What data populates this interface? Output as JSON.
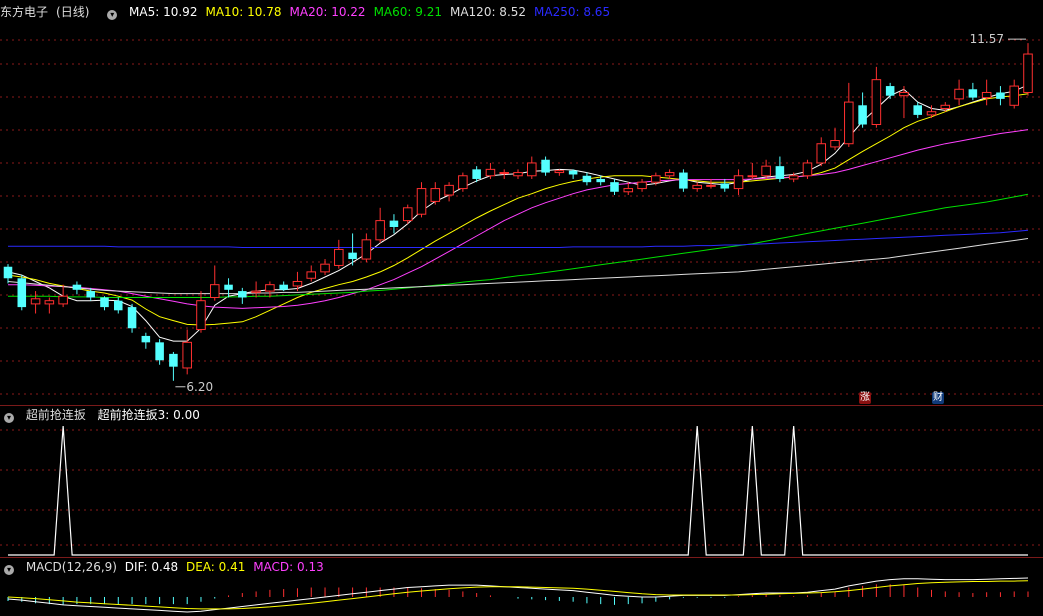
{
  "main": {
    "stock_name": "东方电子",
    "period": "(日线)",
    "ma_legend": [
      {
        "label": "MA5: 10.92",
        "color": "#ffffff"
      },
      {
        "label": "MA10: 10.78",
        "color": "#ffff00"
      },
      {
        "label": "MA20: 10.22",
        "color": "#ff40ff"
      },
      {
        "label": "MA60: 9.21",
        "color": "#00e000"
      },
      {
        "label": "MA120: 8.52",
        "color": "#dddddd"
      },
      {
        "label": "MA250: 8.65",
        "color": "#2a2aff"
      }
    ],
    "high_marker": "11.57",
    "low_marker": "6.20",
    "badges": [
      {
        "label": "涨",
        "bg": "#8a1010",
        "color": "#ffffff"
      },
      {
        "label": "财",
        "bg": "#103a7a",
        "color": "#ffffff"
      }
    ]
  },
  "indicator": {
    "name": "超前抢连扳",
    "legend": "超前抢连扳3: 0.00"
  },
  "macd": {
    "name": "MACD(12,26,9)",
    "dif": "DIF: 0.48",
    "dea": "DEA: 0.41",
    "macd": "MACD: 0.13"
  },
  "colors": {
    "up": "#ff3030",
    "down": "#54ffff",
    "grid": "#8a1a1a"
  },
  "chart_data": {
    "type": "candlestick",
    "ylim": [
      6.0,
      11.9
    ],
    "candles": [
      [
        8.08,
        7.9,
        8.12,
        7.82
      ],
      [
        7.9,
        7.45,
        7.95,
        7.4
      ],
      [
        7.5,
        7.58,
        7.7,
        7.35
      ],
      [
        7.5,
        7.55,
        7.6,
        7.35
      ],
      [
        7.5,
        7.62,
        7.8,
        7.45
      ],
      [
        7.8,
        7.72,
        7.85,
        7.65
      ],
      [
        7.7,
        7.6,
        7.75,
        7.55
      ],
      [
        7.6,
        7.45,
        7.62,
        7.4
      ],
      [
        7.55,
        7.4,
        7.6,
        7.35
      ],
      [
        7.45,
        7.12,
        7.5,
        7.05
      ],
      [
        7.0,
        6.9,
        7.05,
        6.8
      ],
      [
        6.9,
        6.62,
        6.95,
        6.55
      ],
      [
        6.72,
        6.52,
        6.75,
        6.3
      ],
      [
        6.5,
        6.9,
        7.1,
        6.4
      ],
      [
        7.1,
        7.55,
        7.7,
        7.05
      ],
      [
        7.6,
        7.8,
        8.1,
        7.55
      ],
      [
        7.8,
        7.72,
        7.9,
        7.6
      ],
      [
        7.7,
        7.6,
        7.75,
        7.5
      ],
      [
        7.68,
        7.7,
        7.85,
        7.6
      ],
      [
        7.7,
        7.8,
        7.85,
        7.6
      ],
      [
        7.8,
        7.72,
        7.85,
        7.7
      ],
      [
        7.78,
        7.85,
        8.0,
        7.7
      ],
      [
        7.9,
        8.0,
        8.1,
        7.85
      ],
      [
        8.0,
        8.12,
        8.2,
        7.95
      ],
      [
        8.1,
        8.35,
        8.5,
        8.05
      ],
      [
        8.3,
        8.2,
        8.6,
        8.1
      ],
      [
        8.2,
        8.5,
        8.6,
        8.15
      ],
      [
        8.5,
        8.8,
        9.0,
        8.45
      ],
      [
        8.8,
        8.7,
        8.9,
        8.6
      ],
      [
        8.8,
        9.0,
        9.05,
        8.75
      ],
      [
        8.9,
        9.3,
        9.4,
        8.85
      ],
      [
        9.1,
        9.3,
        9.4,
        9.05
      ],
      [
        9.2,
        9.35,
        9.4,
        9.1
      ],
      [
        9.3,
        9.5,
        9.55,
        9.25
      ],
      [
        9.6,
        9.45,
        9.65,
        9.4
      ],
      [
        9.5,
        9.6,
        9.7,
        9.45
      ],
      [
        9.55,
        9.55,
        9.6,
        9.45
      ],
      [
        9.5,
        9.55,
        9.6,
        9.45
      ],
      [
        9.5,
        9.7,
        9.8,
        9.45
      ],
      [
        9.75,
        9.55,
        9.8,
        9.5
      ],
      [
        9.55,
        9.58,
        9.6,
        9.5
      ],
      [
        9.58,
        9.52,
        9.6,
        9.45
      ],
      [
        9.5,
        9.4,
        9.55,
        9.35
      ],
      [
        9.45,
        9.4,
        9.5,
        9.35
      ],
      [
        9.4,
        9.25,
        9.45,
        9.2
      ],
      [
        9.25,
        9.3,
        9.4,
        9.2
      ],
      [
        9.3,
        9.4,
        9.45,
        9.25
      ],
      [
        9.4,
        9.5,
        9.55,
        9.35
      ],
      [
        9.5,
        9.55,
        9.6,
        9.45
      ],
      [
        9.55,
        9.3,
        9.6,
        9.25
      ],
      [
        9.3,
        9.35,
        9.4,
        9.25
      ],
      [
        9.35,
        9.35,
        9.45,
        9.3
      ],
      [
        9.38,
        9.3,
        9.45,
        9.25
      ],
      [
        9.3,
        9.5,
        9.6,
        9.2
      ],
      [
        9.5,
        9.5,
        9.7,
        9.45
      ],
      [
        9.5,
        9.65,
        9.75,
        9.45
      ],
      [
        9.65,
        9.45,
        9.8,
        9.4
      ],
      [
        9.45,
        9.5,
        9.55,
        9.4
      ],
      [
        9.5,
        9.7,
        9.75,
        9.45
      ],
      [
        9.7,
        10.0,
        10.1,
        9.65
      ],
      [
        9.95,
        10.05,
        10.25,
        9.9
      ],
      [
        10.0,
        10.65,
        10.95,
        9.95
      ],
      [
        10.6,
        10.3,
        10.8,
        10.25
      ],
      [
        10.3,
        11.0,
        11.2,
        10.25
      ],
      [
        10.9,
        10.75,
        10.95,
        10.7
      ],
      [
        10.75,
        10.8,
        10.9,
        10.4
      ],
      [
        10.6,
        10.45,
        10.65,
        10.4
      ],
      [
        10.45,
        10.5,
        10.6,
        10.4
      ],
      [
        10.55,
        10.6,
        10.65,
        10.5
      ],
      [
        10.7,
        10.85,
        11.0,
        10.6
      ],
      [
        10.85,
        10.72,
        10.95,
        10.68
      ],
      [
        10.72,
        10.8,
        11.0,
        10.6
      ],
      [
        10.8,
        10.7,
        10.9,
        10.6
      ],
      [
        10.6,
        10.9,
        11.0,
        10.55
      ],
      [
        10.8,
        11.4,
        11.57,
        10.75
      ]
    ],
    "series": [
      {
        "name": "MA5",
        "color": "#ffffff",
        "values": [
          8.0,
          7.95,
          7.85,
          7.75,
          7.62,
          7.55,
          7.55,
          7.56,
          7.55,
          7.46,
          7.24,
          6.98,
          6.92,
          6.92,
          7.12,
          7.48,
          7.62,
          7.66,
          7.7,
          7.72,
          7.72,
          7.74,
          7.82,
          7.92,
          8.02,
          8.15,
          8.28,
          8.45,
          8.58,
          8.75,
          8.95,
          9.1,
          9.2,
          9.32,
          9.42,
          9.5,
          9.52,
          9.53,
          9.57,
          9.58,
          9.6,
          9.59,
          9.55,
          9.5,
          9.45,
          9.4,
          9.35,
          9.38,
          9.42,
          9.45,
          9.4,
          9.38,
          9.36,
          9.4,
          9.45,
          9.48,
          9.5,
          9.52,
          9.57,
          9.68,
          9.85,
          10.1,
          10.35,
          10.55,
          10.75,
          10.85,
          10.65,
          10.55,
          10.52,
          10.58,
          10.65,
          10.72,
          10.78,
          10.82,
          10.92
        ]
      },
      {
        "name": "MA10",
        "color": "#ffff00",
        "values": [
          7.95,
          7.92,
          7.88,
          7.82,
          7.78,
          7.74,
          7.7,
          7.67,
          7.62,
          7.56,
          7.42,
          7.3,
          7.24,
          7.18,
          7.17,
          7.18,
          7.2,
          7.22,
          7.3,
          7.4,
          7.5,
          7.6,
          7.68,
          7.74,
          7.8,
          7.85,
          7.92,
          8.0,
          8.1,
          8.22,
          8.35,
          8.48,
          8.6,
          8.72,
          8.84,
          8.95,
          9.05,
          9.15,
          9.22,
          9.3,
          9.36,
          9.41,
          9.45,
          9.48,
          9.5,
          9.5,
          9.5,
          9.48,
          9.46,
          9.44,
          9.42,
          9.4,
          9.4,
          9.4,
          9.42,
          9.44,
          9.46,
          9.48,
          9.5,
          9.55,
          9.62,
          9.75,
          9.88,
          10.0,
          10.12,
          10.25,
          10.35,
          10.42,
          10.5,
          10.58,
          10.64,
          10.7,
          10.73,
          10.75,
          10.78
        ]
      },
      {
        "name": "MA20",
        "color": "#ff40ff",
        "values": [
          7.8,
          7.8,
          7.79,
          7.78,
          7.77,
          7.76,
          7.74,
          7.72,
          7.7,
          7.66,
          7.62,
          7.58,
          7.54,
          7.5,
          7.47,
          7.45,
          7.44,
          7.43,
          7.44,
          7.45,
          7.46,
          7.48,
          7.51,
          7.55,
          7.6,
          7.66,
          7.72,
          7.8,
          7.88,
          7.98,
          8.08,
          8.2,
          8.32,
          8.44,
          8.56,
          8.68,
          8.8,
          8.9,
          9.0,
          9.08,
          9.15,
          9.22,
          9.28,
          9.32,
          9.36,
          9.38,
          9.4,
          9.42,
          9.43,
          9.44,
          9.44,
          9.44,
          9.44,
          9.44,
          9.45,
          9.46,
          9.47,
          9.48,
          9.5,
          9.52,
          9.55,
          9.6,
          9.66,
          9.72,
          9.78,
          9.84,
          9.9,
          9.95,
          10.0,
          10.04,
          10.08,
          10.12,
          10.16,
          10.19,
          10.22
        ]
      },
      {
        "name": "MA60",
        "color": "#00e000",
        "values": [
          7.62,
          7.62,
          7.62,
          7.62,
          7.61,
          7.61,
          7.61,
          7.6,
          7.6,
          7.6,
          7.6,
          7.6,
          7.6,
          7.6,
          7.6,
          7.6,
          7.61,
          7.61,
          7.62,
          7.62,
          7.63,
          7.64,
          7.65,
          7.66,
          7.67,
          7.68,
          7.7,
          7.71,
          7.73,
          7.75,
          7.77,
          7.79,
          7.81,
          7.84,
          7.86,
          7.88,
          7.91,
          7.94,
          7.96,
          7.99,
          8.02,
          8.05,
          8.08,
          8.11,
          8.14,
          8.17,
          8.2,
          8.23,
          8.26,
          8.29,
          8.32,
          8.35,
          8.38,
          8.41,
          8.44,
          8.48,
          8.52,
          8.56,
          8.6,
          8.64,
          8.68,
          8.72,
          8.76,
          8.8,
          8.84,
          8.88,
          8.92,
          8.96,
          9.0,
          9.03,
          9.06,
          9.09,
          9.13,
          9.17,
          9.21
        ]
      },
      {
        "name": "MA120",
        "color": "#dddddd",
        "values": [
          7.85,
          7.83,
          7.81,
          7.79,
          7.77,
          7.75,
          7.73,
          7.71,
          7.7,
          7.69,
          7.68,
          7.67,
          7.66,
          7.66,
          7.66,
          7.66,
          7.66,
          7.66,
          7.67,
          7.67,
          7.68,
          7.68,
          7.69,
          7.7,
          7.71,
          7.72,
          7.73,
          7.74,
          7.75,
          7.76,
          7.77,
          7.78,
          7.79,
          7.8,
          7.81,
          7.82,
          7.83,
          7.84,
          7.85,
          7.86,
          7.87,
          7.88,
          7.89,
          7.9,
          7.91,
          7.92,
          7.93,
          7.94,
          7.95,
          7.96,
          7.97,
          7.98,
          7.99,
          8.0,
          8.02,
          8.04,
          8.06,
          8.08,
          8.1,
          8.12,
          8.14,
          8.16,
          8.18,
          8.2,
          8.22,
          8.25,
          8.28,
          8.31,
          8.34,
          8.37,
          8.4,
          8.43,
          8.46,
          8.49,
          8.52
        ]
      },
      {
        "name": "MA250",
        "color": "#2a2aff",
        "values": [
          8.4,
          8.4,
          8.4,
          8.4,
          8.4,
          8.4,
          8.4,
          8.4,
          8.39,
          8.39,
          8.39,
          8.39,
          8.39,
          8.39,
          8.39,
          8.39,
          8.39,
          8.38,
          8.38,
          8.38,
          8.38,
          8.38,
          8.38,
          8.38,
          8.38,
          8.38,
          8.38,
          8.38,
          8.38,
          8.38,
          8.38,
          8.38,
          8.38,
          8.38,
          8.38,
          8.38,
          8.38,
          8.38,
          8.38,
          8.38,
          8.38,
          8.39,
          8.39,
          8.39,
          8.39,
          8.39,
          8.39,
          8.4,
          8.4,
          8.4,
          8.41,
          8.41,
          8.42,
          8.42,
          8.43,
          8.44,
          8.45,
          8.46,
          8.47,
          8.48,
          8.49,
          8.5,
          8.51,
          8.52,
          8.53,
          8.54,
          8.55,
          8.56,
          8.57,
          8.58,
          8.59,
          8.6,
          8.61,
          8.63,
          8.65
        ]
      }
    ],
    "signal": {
      "name": "超前抢连扳3",
      "peaks_at": [
        4,
        50,
        54,
        57
      ]
    },
    "macd_series": {
      "dif": [
        -0.05,
        -0.08,
        -0.12,
        -0.16,
        -0.2,
        -0.22,
        -0.24,
        -0.26,
        -0.28,
        -0.3,
        -0.32,
        -0.34,
        -0.36,
        -0.38,
        -0.36,
        -0.32,
        -0.28,
        -0.24,
        -0.2,
        -0.16,
        -0.12,
        -0.08,
        -0.04,
        0.0,
        0.04,
        0.08,
        0.12,
        0.16,
        0.2,
        0.24,
        0.26,
        0.28,
        0.3,
        0.3,
        0.3,
        0.28,
        0.26,
        0.24,
        0.22,
        0.2,
        0.18,
        0.16,
        0.12,
        0.08,
        0.04,
        0.02,
        0.0,
        0.0,
        0.02,
        0.04,
        0.04,
        0.04,
        0.04,
        0.06,
        0.08,
        0.1,
        0.1,
        0.1,
        0.12,
        0.16,
        0.2,
        0.28,
        0.34,
        0.4,
        0.44,
        0.46,
        0.46,
        0.45,
        0.44,
        0.44,
        0.44,
        0.45,
        0.46,
        0.47,
        0.48
      ],
      "dea": [
        0.0,
        -0.02,
        -0.04,
        -0.07,
        -0.1,
        -0.13,
        -0.15,
        -0.17,
        -0.19,
        -0.21,
        -0.23,
        -0.25,
        -0.27,
        -0.29,
        -0.3,
        -0.3,
        -0.3,
        -0.29,
        -0.27,
        -0.25,
        -0.22,
        -0.19,
        -0.16,
        -0.12,
        -0.08,
        -0.04,
        0.0,
        0.04,
        0.08,
        0.12,
        0.15,
        0.18,
        0.21,
        0.23,
        0.25,
        0.26,
        0.26,
        0.26,
        0.25,
        0.24,
        0.23,
        0.22,
        0.2,
        0.17,
        0.14,
        0.11,
        0.08,
        0.06,
        0.05,
        0.05,
        0.05,
        0.05,
        0.05,
        0.05,
        0.06,
        0.07,
        0.08,
        0.09,
        0.1,
        0.11,
        0.13,
        0.16,
        0.2,
        0.24,
        0.28,
        0.31,
        0.34,
        0.36,
        0.37,
        0.38,
        0.39,
        0.39,
        0.4,
        0.4,
        0.41
      ]
    }
  }
}
